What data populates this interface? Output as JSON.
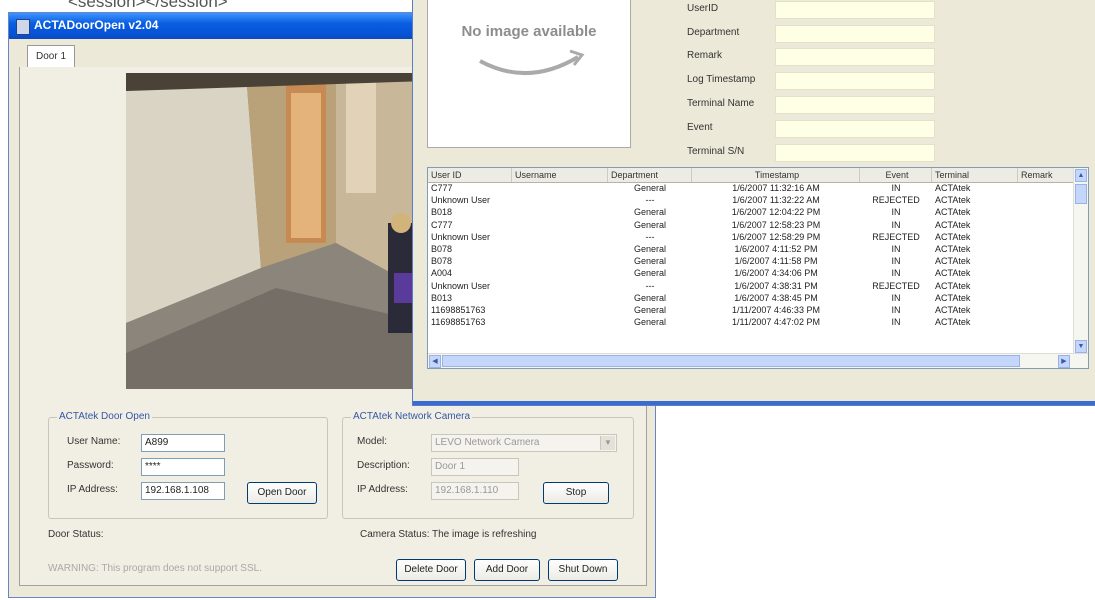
{
  "clipped_header_text": "<session></session>",
  "main_window": {
    "title": "ACTADoorOpen v2.04",
    "tab_label": "Door 1",
    "door_open_group": {
      "title": "ACTAtek Door Open",
      "user_name_label": "User Name:",
      "user_name_value": "A899",
      "password_label": "Password:",
      "password_value": "****",
      "ip_label": "IP Address:",
      "ip_value": "192.168.1.108",
      "open_door_button": "Open Door"
    },
    "camera_group": {
      "title": "ACTAtek Network Camera",
      "model_label": "Model:",
      "model_value": "LEVO Network Camera",
      "description_label": "Description:",
      "description_value": "Door 1",
      "ip_label": "IP Address:",
      "ip_value": "192.168.1.110",
      "stop_button": "Stop"
    },
    "door_status_label": "Door Status:",
    "camera_status_label": "Camera Status:",
    "camera_status_value": "The image is refreshing",
    "warning_text": "WARNING: This program does not support SSL.",
    "buttons": {
      "delete_door": "Delete Door",
      "add_door": "Add Door",
      "shut_down": "Shut Down"
    },
    "icons": {
      "app": "app-window-icon"
    }
  },
  "log_window": {
    "no_image_text": "No image available",
    "detail_labels": [
      "UserID",
      "Department",
      "Remark",
      "Log Timestamp",
      "Terminal Name",
      "Event",
      "Terminal S/N"
    ],
    "columns": [
      "User ID",
      "Username",
      "Department",
      "Timestamp",
      "Event",
      "Terminal",
      "Remark"
    ],
    "rows": [
      [
        "C777",
        "",
        "General",
        "1/6/2007 11:32:16 AM",
        "IN",
        "ACTAtek",
        ""
      ],
      [
        "Unknown User",
        "",
        "---",
        "1/6/2007 11:32:22 AM",
        "REJECTED",
        "ACTAtek",
        ""
      ],
      [
        "B018",
        "",
        "General",
        "1/6/2007 12:04:22 PM",
        "IN",
        "ACTAtek",
        ""
      ],
      [
        "C777",
        "",
        "General",
        "1/6/2007 12:58:23 PM",
        "IN",
        "ACTAtek",
        ""
      ],
      [
        "Unknown User",
        "",
        "---",
        "1/6/2007 12:58:29 PM",
        "REJECTED",
        "ACTAtek",
        ""
      ],
      [
        "B078",
        "",
        "General",
        "1/6/2007 4:11:52 PM",
        "IN",
        "ACTAtek",
        ""
      ],
      [
        "B078",
        "",
        "General",
        "1/6/2007 4:11:58 PM",
        "IN",
        "ACTAtek",
        ""
      ],
      [
        "A004",
        "",
        "General",
        "1/6/2007 4:34:06 PM",
        "IN",
        "ACTAtek",
        ""
      ],
      [
        "Unknown User",
        "",
        "---",
        "1/6/2007 4:38:31 PM",
        "REJECTED",
        "ACTAtek",
        ""
      ],
      [
        "B013",
        "",
        "General",
        "1/6/2007 4:38:45 PM",
        "IN",
        "ACTAtek",
        ""
      ],
      [
        "11698851763",
        "",
        "General",
        "1/11/2007 4:46:33 PM",
        "IN",
        "ACTAtek",
        ""
      ],
      [
        "11698851763",
        "",
        "General",
        "1/11/2007 4:47:02 PM",
        "IN",
        "ACTAtek",
        ""
      ]
    ]
  }
}
